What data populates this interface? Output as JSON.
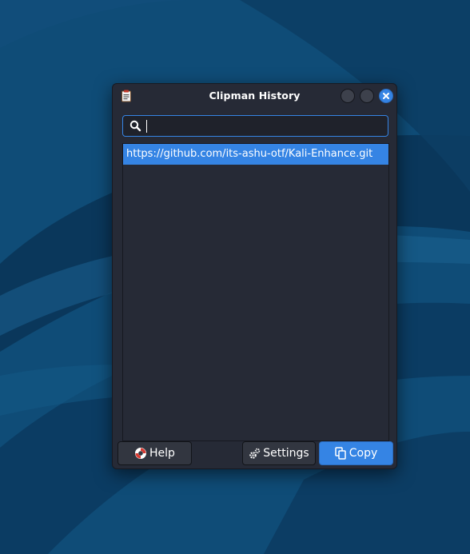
{
  "window": {
    "title": "Clipman History"
  },
  "search": {
    "value": "",
    "placeholder": ""
  },
  "history": {
    "items": [
      {
        "text": "https://github.com/its-ashu-otf/Kali-Enhance.git",
        "selected": true
      }
    ]
  },
  "buttons": {
    "help": "Help",
    "settings": "Settings",
    "copy": "Copy"
  },
  "icons": {
    "app": "clipboard-icon",
    "search": "search-icon",
    "help": "lifebuoy-icon",
    "settings": "gear-icon",
    "copy": "copy-icon",
    "close": "close-icon"
  },
  "colors": {
    "desktop": "#0f4c77",
    "window": "#262a36",
    "accent": "#3584e4"
  }
}
